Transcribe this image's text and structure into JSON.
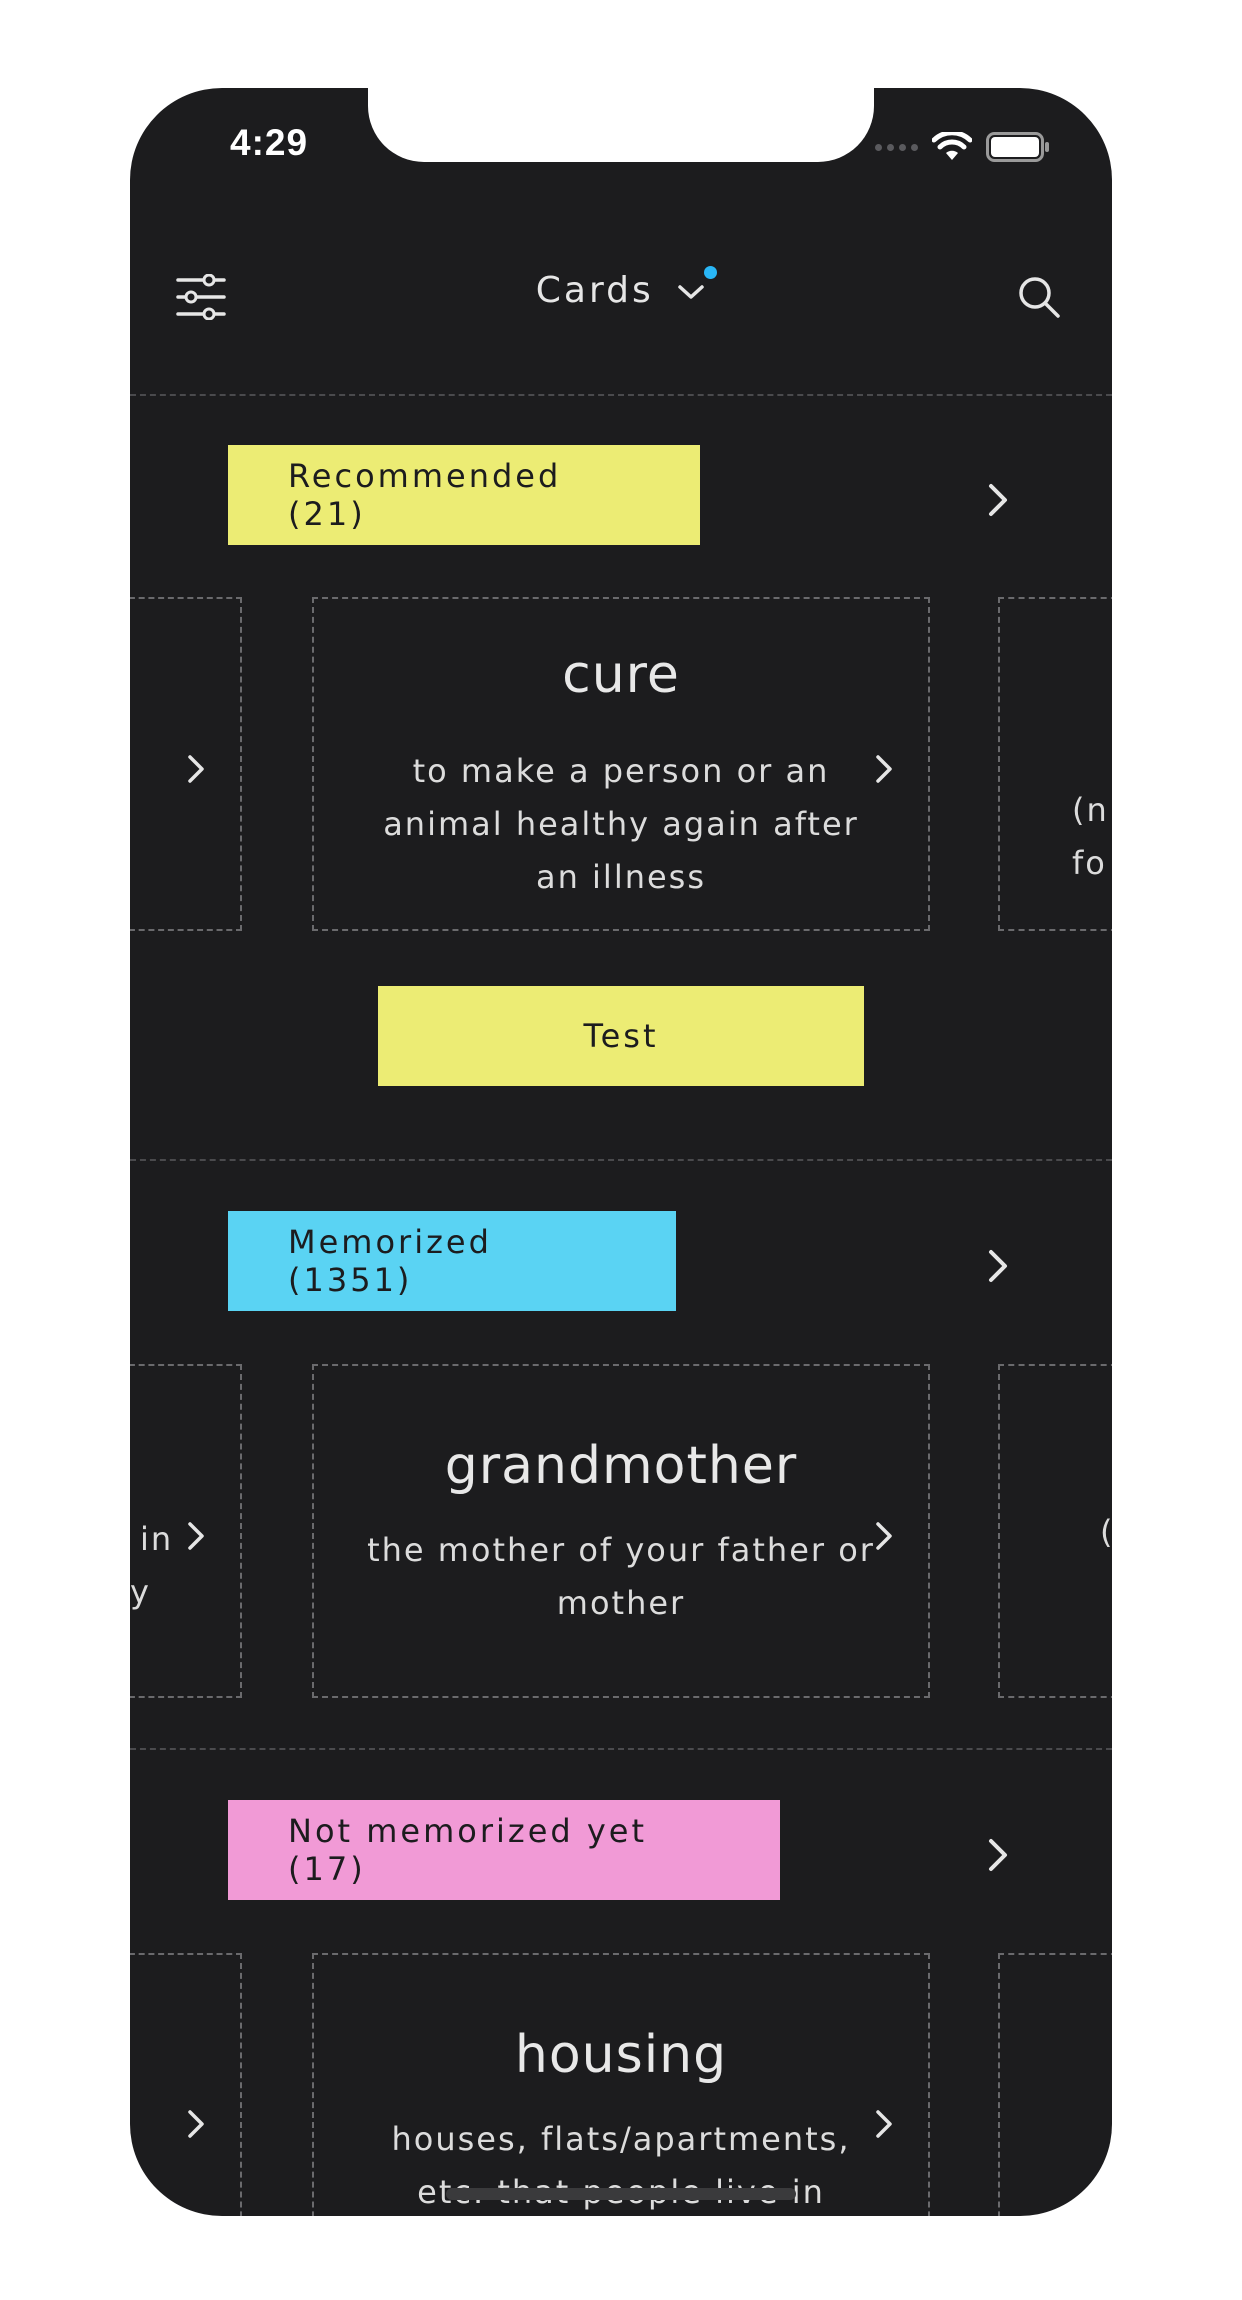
{
  "status_bar": {
    "time": "4:29"
  },
  "header": {
    "title": "Cards"
  },
  "sections": [
    {
      "label": "Recommended (21)",
      "color": "#ecec74",
      "card": {
        "word": "cure",
        "definition_lines": [
          "to make a person or an",
          "animal healthy again after",
          "an illness"
        ]
      },
      "next_card_partial": [
        "(n.",
        "fo"
      ],
      "test_label": "Test"
    },
    {
      "label": "Memorized (1351)",
      "color": "#5ad3f3",
      "card": {
        "word": "grandmother",
        "definition_lines": [
          "the mother of your father or",
          "mother"
        ]
      },
      "prev_card_partial": [
        "in",
        "y"
      ],
      "next_card_partial": [
        "("
      ]
    },
    {
      "label": "Not memorized yet (17)",
      "color": "#f19ad6",
      "card": {
        "word": "housing",
        "definition_lines": [
          "houses, flats/apartments,",
          "etc. that people live in"
        ]
      }
    }
  ]
}
